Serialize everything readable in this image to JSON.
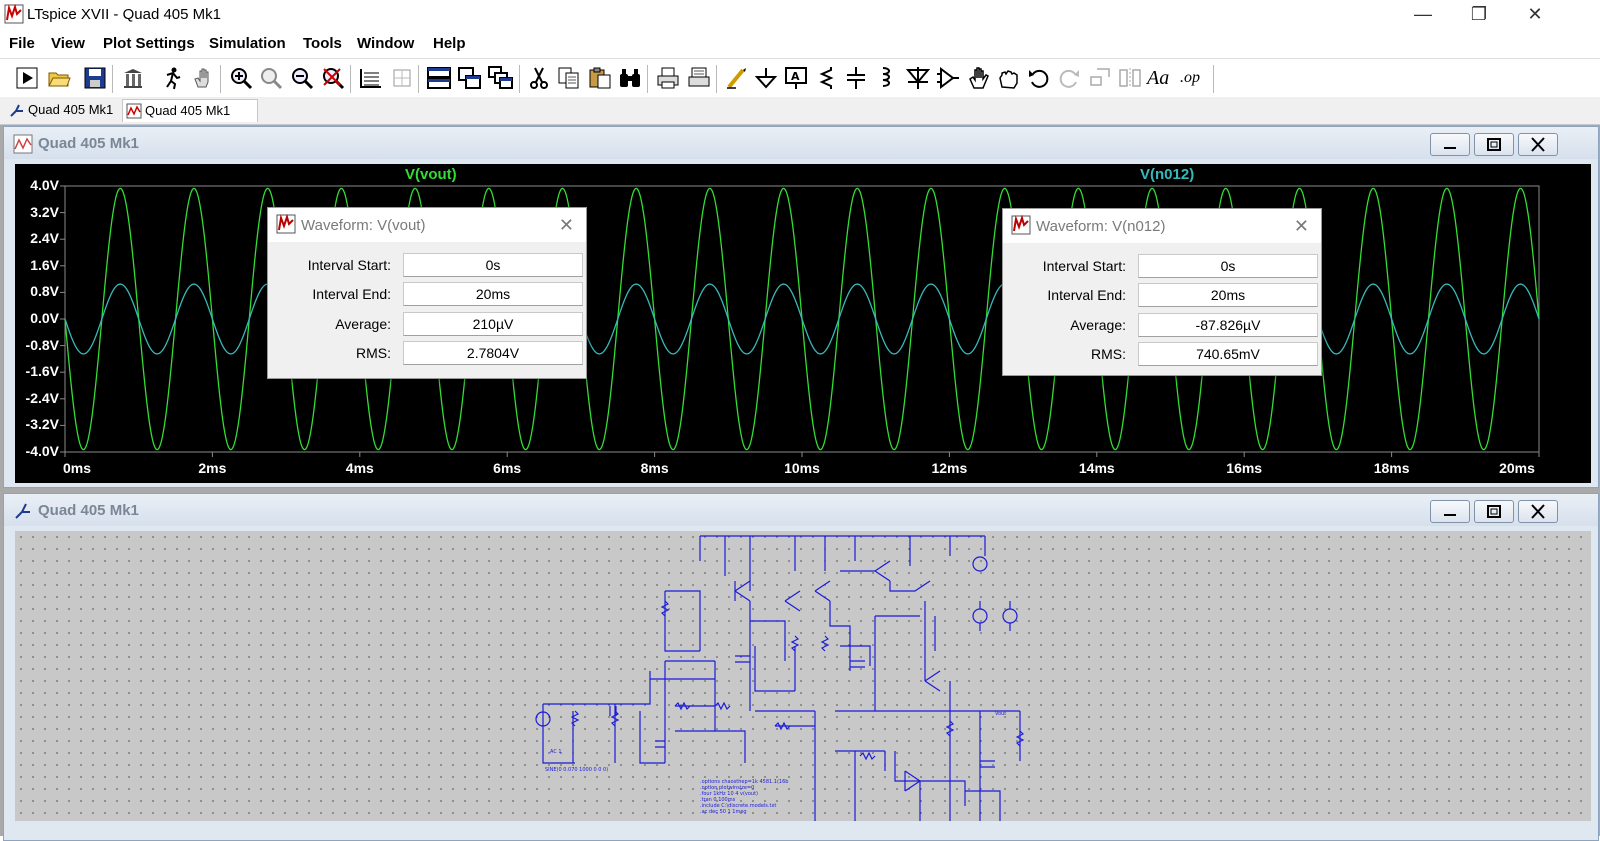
{
  "window": {
    "title": "LTspice XVII - Quad 405 Mk1",
    "minimize_glyph": "—",
    "restore_glyph": "❐",
    "close_glyph": "✕"
  },
  "menu": [
    "File",
    "View",
    "Plot Settings",
    "Simulation",
    "Tools",
    "Window",
    "Help"
  ],
  "toolbar": {
    "icons": [
      "run-icon",
      "open-icon",
      "save-icon",
      "control-panel-icon",
      "halt-icon",
      "pan-icon",
      "zoom-in-icon",
      "zoom-area-icon",
      "zoom-out-icon",
      "zoom-cancel-icon",
      "autorange-icon",
      "grid-icon",
      "tile-horizontal-icon",
      "tile-vertical-icon",
      "cascade-icon",
      "cut-icon",
      "copy-icon",
      "paste-icon",
      "find-icon",
      "print-icon",
      "print-setup-icon",
      "wire-icon",
      "ground-icon",
      "label-icon",
      "resistor-icon",
      "capacitor-icon",
      "inductor-icon",
      "diode-icon",
      "component-icon",
      "move-icon",
      "drag-icon",
      "undo-icon",
      "redo-icon",
      "rotate-icon",
      "mirror-icon",
      "text-icon",
      "spice-directive-icon"
    ],
    "text_label": "Aa",
    "op_label": ".op"
  },
  "tabs": [
    {
      "label": "Quad 405 Mk1",
      "icon": "schematic-icon",
      "active": false
    },
    {
      "label": "Quad 405 Mk1",
      "icon": "waveform-icon",
      "active": true
    }
  ],
  "waveform_window": {
    "title": "Quad 405 Mk1",
    "icon": "waveform-icon"
  },
  "schematic_window": {
    "title": "Quad 405 Mk1",
    "icon": "schematic-icon"
  },
  "chart_data": {
    "type": "line",
    "title": "",
    "xlabel": "",
    "ylabel": "",
    "x_ticks": [
      "0ms",
      "2ms",
      "4ms",
      "6ms",
      "8ms",
      "10ms",
      "12ms",
      "14ms",
      "16ms",
      "18ms",
      "20ms"
    ],
    "y_ticks": [
      "4.0V",
      "3.2V",
      "2.4V",
      "1.6V",
      "0.8V",
      "0.0V",
      "-0.8V",
      "-1.6V",
      "-2.4V",
      "-3.2V",
      "-4.0V"
    ],
    "xlim": [
      0,
      20
    ],
    "ylim": [
      -4.0,
      4.0
    ],
    "grid": false,
    "background": "#000000",
    "series": [
      {
        "name": "V(vout)",
        "color": "#33dd33",
        "amplitude": 3.93,
        "frequency_khz": 1.0,
        "phase_deg": 180
      },
      {
        "name": "V(n012)",
        "color": "#38b8b8",
        "amplitude": 1.05,
        "frequency_khz": 1.0,
        "phase_deg": 180
      }
    ]
  },
  "dialogs": [
    {
      "title": "Waveform: V(vout)",
      "close": "✕",
      "rows": [
        {
          "label": "Interval Start:",
          "value": "0s"
        },
        {
          "label": "Interval End:",
          "value": "20ms"
        },
        {
          "label": "Average:",
          "value": "210µV"
        },
        {
          "label": "RMS:",
          "value": "2.7804V"
        }
      ]
    },
    {
      "title": "Waveform: V(n012)",
      "close": "✕",
      "rows": [
        {
          "label": "Interval Start:",
          "value": "0s"
        },
        {
          "label": "Interval End:",
          "value": "20ms"
        },
        {
          "label": "Average:",
          "value": "-87.826µV"
        },
        {
          "label": "RMS:",
          "value": "740.65mV"
        }
      ]
    }
  ],
  "schematic": {
    "source_label": "SINE(0 0.070 1000 0 0 0)",
    "net_vout": "Vout",
    "directives": [
      ".options chaosthep=1k 4581.1(16b",
      ".option plotwinsize=0",
      ".four 1kHz 10 4 v(vout)",
      ".tran 0 100ms",
      ".include C:\\discrete.models.txt",
      ".ac dec 50 1 1meg"
    ]
  }
}
